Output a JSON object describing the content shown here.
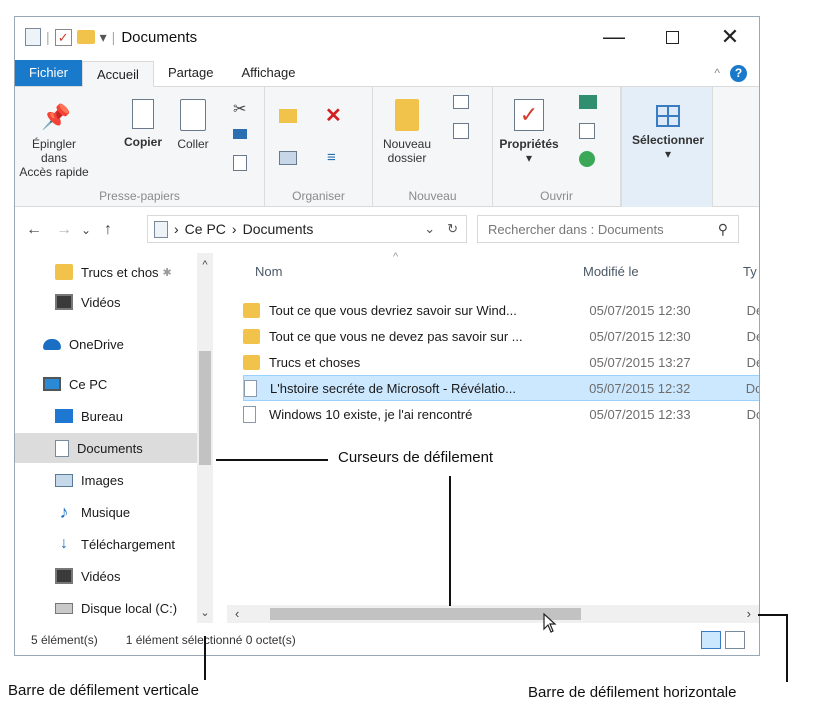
{
  "window": {
    "title": "Documents",
    "controls": {
      "minimize": "—",
      "maximize": "",
      "close": "✕"
    }
  },
  "ribbon": {
    "tabs": [
      "Fichier",
      "Accueil",
      "Partage",
      "Affichage"
    ],
    "active_tab": "Accueil",
    "collapse_glyph": "^",
    "help": "?",
    "groups": {
      "presse_papiers": {
        "label": "Presse-papiers",
        "pin": "Épingler dans",
        "pin2": "Accès rapide",
        "copy": "Copier",
        "paste": "Coller"
      },
      "organiser": {
        "label": "Organiser"
      },
      "nouveau": {
        "label": "Nouveau",
        "new_folder": "Nouveau",
        "new_folder2": "dossier"
      },
      "ouvrir": {
        "label": "Ouvrir",
        "properties": "Propriétés"
      },
      "selectionner": {
        "label": "Sélectionner"
      }
    }
  },
  "navbar": {
    "back": "←",
    "forward": "→",
    "recent": "⌄",
    "up": "↑",
    "path": [
      "Ce PC",
      "Documents"
    ],
    "path_sep": "›",
    "refresh": "↻",
    "dropdown": "⌄",
    "search_placeholder": "Rechercher dans : Documents",
    "search_glyph": "⚲"
  },
  "nav_pane": {
    "items": [
      {
        "label": "Trucs et chos",
        "icon": "folder-icon"
      },
      {
        "label": "Vidéos",
        "icon": "video-icon"
      },
      {
        "label": "OneDrive",
        "icon": "cloud-icon"
      },
      {
        "label": "Ce PC",
        "icon": "pc-icon"
      },
      {
        "label": "Bureau",
        "icon": "desktop-icon"
      },
      {
        "label": "Documents",
        "icon": "documents-icon",
        "selected": true
      },
      {
        "label": "Images",
        "icon": "images-icon"
      },
      {
        "label": "Musique",
        "icon": "music-icon"
      },
      {
        "label": "Téléchargement",
        "icon": "download-icon"
      },
      {
        "label": "Vidéos",
        "icon": "video-icon"
      },
      {
        "label": "Disque local (C:)",
        "icon": "disk-icon"
      }
    ],
    "pin_glyph": "✱",
    "scroll_up": "^",
    "scroll_down": "⌄"
  },
  "file_list": {
    "columns": [
      "Nom",
      "Modifié le",
      "Ty"
    ],
    "sort_glyph": "^",
    "rows": [
      {
        "name": "Tout ce que vous devriez savoir sur Wind...",
        "date": "05/07/2015 12:30",
        "type": "De",
        "kind": "folder"
      },
      {
        "name": "Tout ce que vous ne devez pas savoir sur ...",
        "date": "05/07/2015 12:30",
        "type": "De",
        "kind": "folder"
      },
      {
        "name": "Trucs et choses",
        "date": "05/07/2015 13:27",
        "type": "De",
        "kind": "folder"
      },
      {
        "name": "L'hstoire secréte de Microsoft - Révélatio...",
        "date": "05/07/2015 12:32",
        "type": "Do",
        "kind": "file",
        "selected": true
      },
      {
        "name": "Windows 10 existe, je l'ai rencontré",
        "date": "05/07/2015 12:33",
        "type": "Do",
        "kind": "file"
      }
    ]
  },
  "hscroll": {
    "left": "‹",
    "right": "›",
    "thumb_start": 0.04,
    "thumb_fraction": 0.64
  },
  "vscroll": {
    "thumb_start": 0.24,
    "thumb_fraction": 0.34
  },
  "status": {
    "count": "5 élément(s)",
    "selection": "1 élément sélectionné 0 octet(s)"
  },
  "callouts": {
    "cursors": "Curseurs de défilement",
    "vertical": "Barre de défilement verticale",
    "horizontal": "Barre de défilement horizontale"
  },
  "colors": {
    "accent": "#1979ca",
    "selection": "#cce8ff",
    "folder": "#f2c34b"
  }
}
